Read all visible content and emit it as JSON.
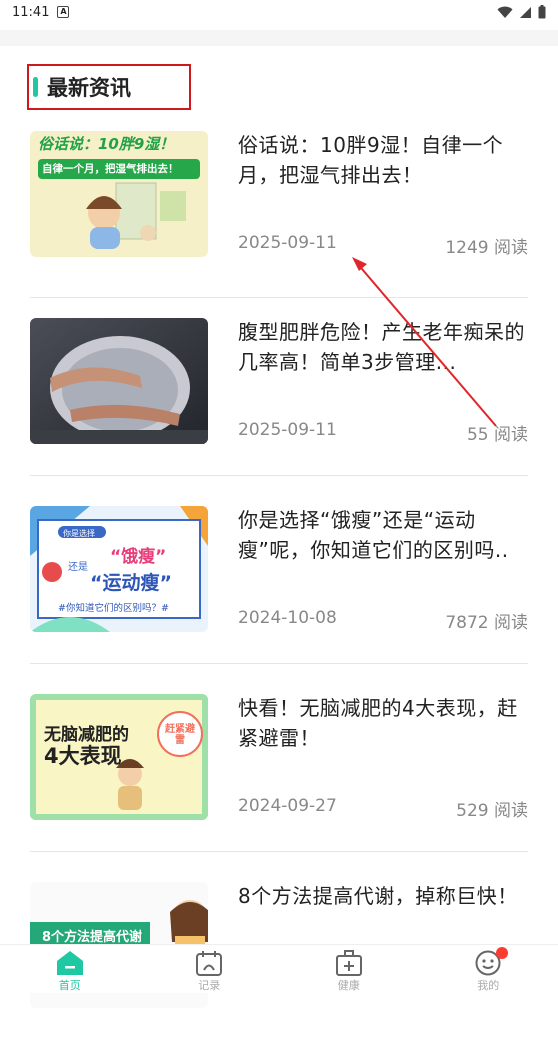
{
  "status": {
    "time": "11:41",
    "notif_icon": "a-icon"
  },
  "section": {
    "title": "最新资讯",
    "accent": "#1ec8a3",
    "highlight": "#d0181c"
  },
  "articles": [
    {
      "title": "俗话说：10胖9湿！自律一个月，把湿气排出去！",
      "date": "2025-09-11",
      "reads": "1249 阅读",
      "thumb": {
        "headline": "俗话说：10胖9湿！",
        "sub": "自律一个月，把湿气排出去！"
      }
    },
    {
      "title": "腹型肥胖危险！产生老年痴呆的几率高！简单3步管理...",
      "date": "2025-09-11",
      "reads": "55 阅读",
      "thumb": {}
    },
    {
      "title": "你是选择“饿瘦”还是“运动瘦”呢，你知道它们的区别吗..",
      "date": "2024-10-08",
      "reads": "7872 阅读",
      "thumb": {
        "tag": "你是选择",
        "w1": "“饿瘦”",
        "mid": "还是",
        "w2": "“运动瘦”",
        "foot": "#你知道它们的区别吗？#"
      }
    },
    {
      "title": "快看！无脑减肥的4大表现，赶紧避雷！",
      "date": "2024-09-27",
      "reads": "529 阅读",
      "thumb": {
        "l1": "无脑减肥的",
        "l2": "4大表现",
        "stamp": "赶紧避雷"
      }
    },
    {
      "title": "8个方法提高代谢，掉称巨快！",
      "date": "",
      "reads": "",
      "thumb": {
        "label": "8个方法提高代谢"
      }
    }
  ],
  "nav": [
    {
      "label": "首页",
      "icon": "home-icon",
      "active": true
    },
    {
      "label": "记录",
      "icon": "calendar-icon",
      "active": false
    },
    {
      "label": "健康",
      "icon": "medkit-icon",
      "active": false
    },
    {
      "label": "我的",
      "icon": "smiley-icon",
      "active": false
    }
  ],
  "colors": {
    "active": "#1ec8a3",
    "muted": "#888888",
    "text": "#222222"
  }
}
